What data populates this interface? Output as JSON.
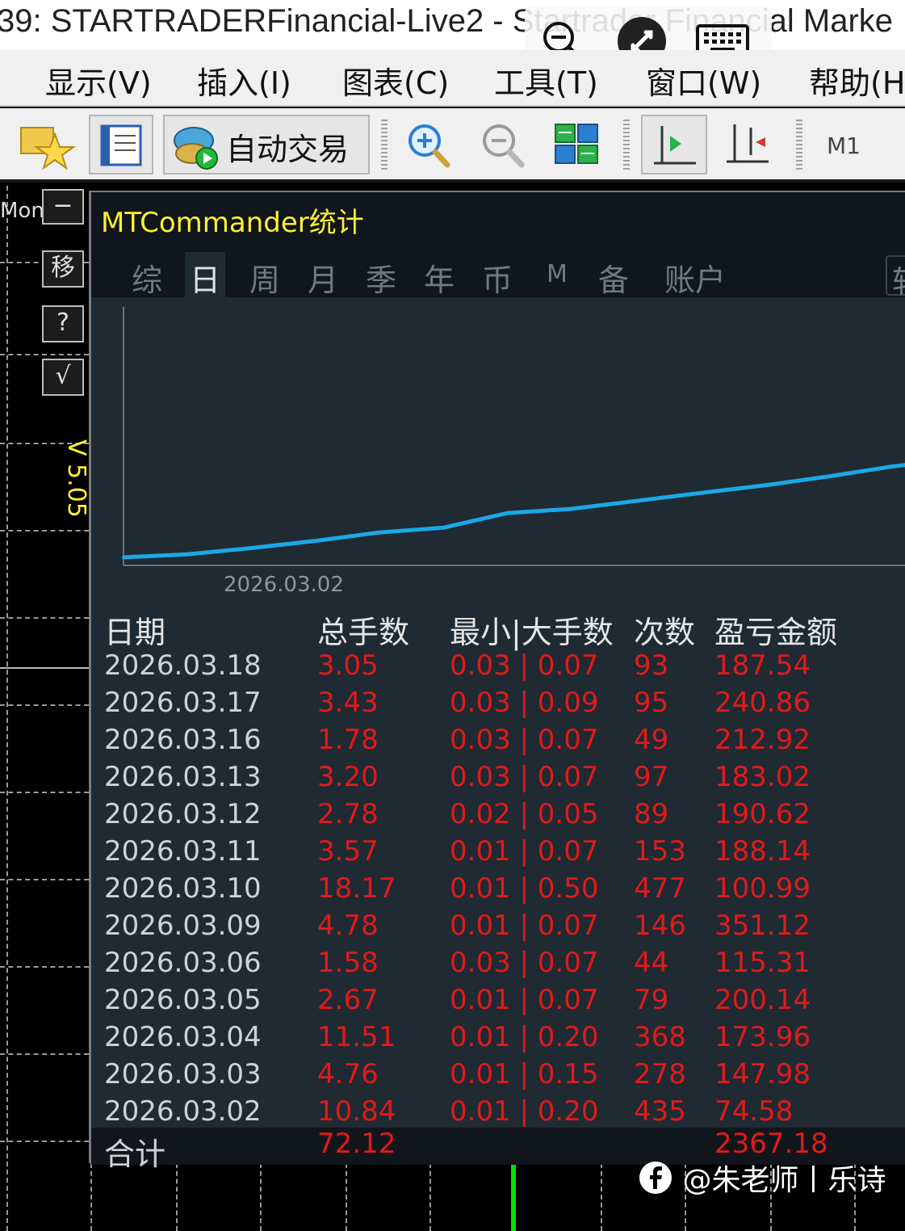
{
  "window": {
    "title": "39: STARTRADERFinancial-Live2 - Startrader Financial Marke"
  },
  "remote_toolbar": {
    "icons": [
      "zoom-out-icon",
      "remote-connect-icon",
      "keyboard-icon"
    ]
  },
  "menu": {
    "items": [
      "显示(V)",
      "插入(I)",
      "图表(C)",
      "工具(T)",
      "窗口(W)",
      "帮助(H"
    ]
  },
  "toolbar": {
    "autotrade_label": "自动交易",
    "timeframe_label": "M1"
  },
  "side_panel": {
    "mont_label": "Mont",
    "buttons": [
      "−",
      "移",
      "?",
      "√"
    ],
    "version": "V 5.05"
  },
  "stats": {
    "title": "MTCommander统计",
    "tabs": [
      "综",
      "日",
      "周",
      "月",
      "季",
      "年",
      "币",
      "M",
      "备",
      "账户",
      "轨"
    ],
    "active_tab": "日",
    "columns": [
      "日期",
      "总手数",
      "最小|大手数",
      "次数",
      "盈亏金额"
    ],
    "rows": [
      {
        "date": "2026.03.18",
        "lots": "3.05",
        "minmax": "0.03 | 0.07",
        "count": "93",
        "pnl": "187.54"
      },
      {
        "date": "2026.03.17",
        "lots": "3.43",
        "minmax": "0.03 | 0.09",
        "count": "95",
        "pnl": "240.86"
      },
      {
        "date": "2026.03.16",
        "lots": "1.78",
        "minmax": "0.03 | 0.07",
        "count": "49",
        "pnl": "212.92"
      },
      {
        "date": "2026.03.13",
        "lots": "3.20",
        "minmax": "0.03 | 0.07",
        "count": "97",
        "pnl": "183.02"
      },
      {
        "date": "2026.03.12",
        "lots": "2.78",
        "minmax": "0.02 | 0.05",
        "count": "89",
        "pnl": "190.62"
      },
      {
        "date": "2026.03.11",
        "lots": "3.57",
        "minmax": "0.01 | 0.07",
        "count": "153",
        "pnl": "188.14"
      },
      {
        "date": "2026.03.10",
        "lots": "18.17",
        "minmax": "0.01 | 0.50",
        "count": "477",
        "pnl": "100.99"
      },
      {
        "date": "2026.03.09",
        "lots": "4.78",
        "minmax": "0.01 | 0.07",
        "count": "146",
        "pnl": "351.12"
      },
      {
        "date": "2026.03.06",
        "lots": "1.58",
        "minmax": "0.03 | 0.07",
        "count": "44",
        "pnl": "115.31"
      },
      {
        "date": "2026.03.05",
        "lots": "2.67",
        "minmax": "0.01 | 0.07",
        "count": "79",
        "pnl": "200.14"
      },
      {
        "date": "2026.03.04",
        "lots": "11.51",
        "minmax": "0.01 | 0.20",
        "count": "368",
        "pnl": "173.96"
      },
      {
        "date": "2026.03.03",
        "lots": "4.76",
        "minmax": "0.01 | 0.15",
        "count": "278",
        "pnl": "147.98"
      },
      {
        "date": "2026.03.02",
        "lots": "10.84",
        "minmax": "0.01 | 0.20",
        "count": "435",
        "pnl": "74.58"
      }
    ],
    "total": {
      "label": "合计",
      "lots": "72.12",
      "pnl": "2367.18"
    }
  },
  "chart_data": {
    "type": "line",
    "title": "",
    "xlabel": "",
    "ylabel": "",
    "x_tick_labels": [
      "2026.03.02"
    ],
    "x": [
      "2026.03.02",
      "2026.03.03",
      "2026.03.04",
      "2026.03.05",
      "2026.03.06",
      "2026.03.09",
      "2026.03.10",
      "2026.03.11",
      "2026.03.12",
      "2026.03.13",
      "2026.03.16",
      "2026.03.17",
      "2026.03.18"
    ],
    "series": [
      {
        "values": [
          0,
          74.58,
          222.56,
          396.52,
          596.66,
          711.97,
          1063.09,
          1164.08,
          1352.22,
          1542.84,
          1725.86,
          1938.78,
          2179.64,
          2367.18
        ],
        "color": "#1aa8e8"
      }
    ],
    "x_count_with_origin": 14,
    "ylim": [
      0,
      2367.18
    ],
    "grid": false
  },
  "watermark": {
    "text": "@朱老师丨乐诗"
  },
  "colors": {
    "panel_bg": "#1f2a33",
    "header_bg": "#10161b",
    "value_red": "#e11a1a",
    "line_blue": "#1aa8e8",
    "title_yellow": "#ffef33"
  }
}
